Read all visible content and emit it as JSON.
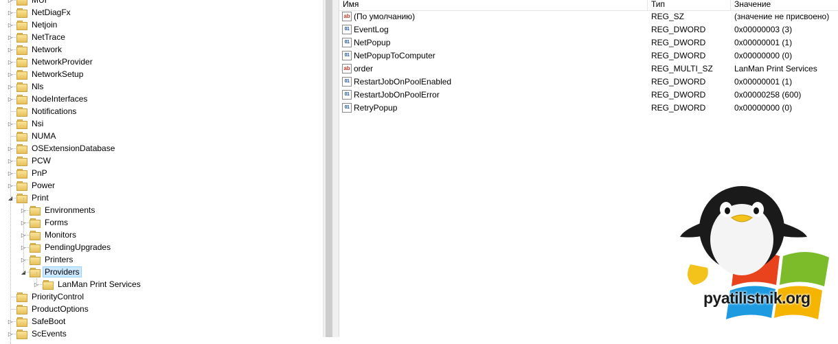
{
  "tree": {
    "nodes": [
      {
        "label": "MUI",
        "depth": 0,
        "expander": "collapsed"
      },
      {
        "label": "NetDiagFx",
        "depth": 0,
        "expander": "collapsed"
      },
      {
        "label": "Netjoin",
        "depth": 0,
        "expander": "collapsed"
      },
      {
        "label": "NetTrace",
        "depth": 0,
        "expander": "collapsed"
      },
      {
        "label": "Network",
        "depth": 0,
        "expander": "collapsed"
      },
      {
        "label": "NetworkProvider",
        "depth": 0,
        "expander": "collapsed"
      },
      {
        "label": "NetworkSetup",
        "depth": 0,
        "expander": "collapsed"
      },
      {
        "label": "Nls",
        "depth": 0,
        "expander": "collapsed"
      },
      {
        "label": "NodeInterfaces",
        "depth": 0,
        "expander": "collapsed"
      },
      {
        "label": "Notifications",
        "depth": 0,
        "expander": "none"
      },
      {
        "label": "Nsi",
        "depth": 0,
        "expander": "collapsed"
      },
      {
        "label": "NUMA",
        "depth": 0,
        "expander": "none"
      },
      {
        "label": "OSExtensionDatabase",
        "depth": 0,
        "expander": "collapsed"
      },
      {
        "label": "PCW",
        "depth": 0,
        "expander": "collapsed"
      },
      {
        "label": "PnP",
        "depth": 0,
        "expander": "collapsed"
      },
      {
        "label": "Power",
        "depth": 0,
        "expander": "collapsed"
      },
      {
        "label": "Print",
        "depth": 0,
        "expander": "expanded"
      },
      {
        "label": "Environments",
        "depth": 1,
        "expander": "collapsed"
      },
      {
        "label": "Forms",
        "depth": 1,
        "expander": "collapsed"
      },
      {
        "label": "Monitors",
        "depth": 1,
        "expander": "collapsed"
      },
      {
        "label": "PendingUpgrades",
        "depth": 1,
        "expander": "collapsed"
      },
      {
        "label": "Printers",
        "depth": 1,
        "expander": "collapsed"
      },
      {
        "label": "Providers",
        "depth": 1,
        "expander": "expanded",
        "selected": true
      },
      {
        "label": "LanMan Print Services",
        "depth": 2,
        "expander": "collapsed"
      },
      {
        "label": "PriorityControl",
        "depth": 0,
        "expander": "none"
      },
      {
        "label": "ProductOptions",
        "depth": 0,
        "expander": "none"
      },
      {
        "label": "SafeBoot",
        "depth": 0,
        "expander": "collapsed"
      },
      {
        "label": "ScEvents",
        "depth": 0,
        "expander": "collapsed"
      }
    ]
  },
  "list": {
    "headers": {
      "name": "Имя",
      "type": "Тип",
      "value": "Значение"
    },
    "rows": [
      {
        "icon": "string-value-icon",
        "name": "(По умолчанию)",
        "type": "REG_SZ",
        "value": "(значение не присвоено)"
      },
      {
        "icon": "binary-value-icon",
        "name": "EventLog",
        "type": "REG_DWORD",
        "value": "0x00000003 (3)"
      },
      {
        "icon": "binary-value-icon",
        "name": "NetPopup",
        "type": "REG_DWORD",
        "value": "0x00000001 (1)"
      },
      {
        "icon": "binary-value-icon",
        "name": "NetPopupToComputer",
        "type": "REG_DWORD",
        "value": "0x00000000 (0)"
      },
      {
        "icon": "string-value-icon",
        "name": "order",
        "type": "REG_MULTI_SZ",
        "value": "LanMan Print Services"
      },
      {
        "icon": "binary-value-icon",
        "name": "RestartJobOnPoolEnabled",
        "type": "REG_DWORD",
        "value": "0x00000001 (1)"
      },
      {
        "icon": "binary-value-icon",
        "name": "RestartJobOnPoolError",
        "type": "REG_DWORD",
        "value": "0x00000258 (600)"
      },
      {
        "icon": "binary-value-icon",
        "name": "RetryPopup",
        "type": "REG_DWORD",
        "value": "0x00000000 (0)"
      }
    ]
  },
  "icons": {
    "string_glyph": "ab",
    "dword_glyph": "010\n110"
  },
  "watermark": {
    "text": "pyatilistnik.org"
  },
  "colors": {
    "selection": "#cce8ff",
    "folder": "#e7c05a"
  }
}
